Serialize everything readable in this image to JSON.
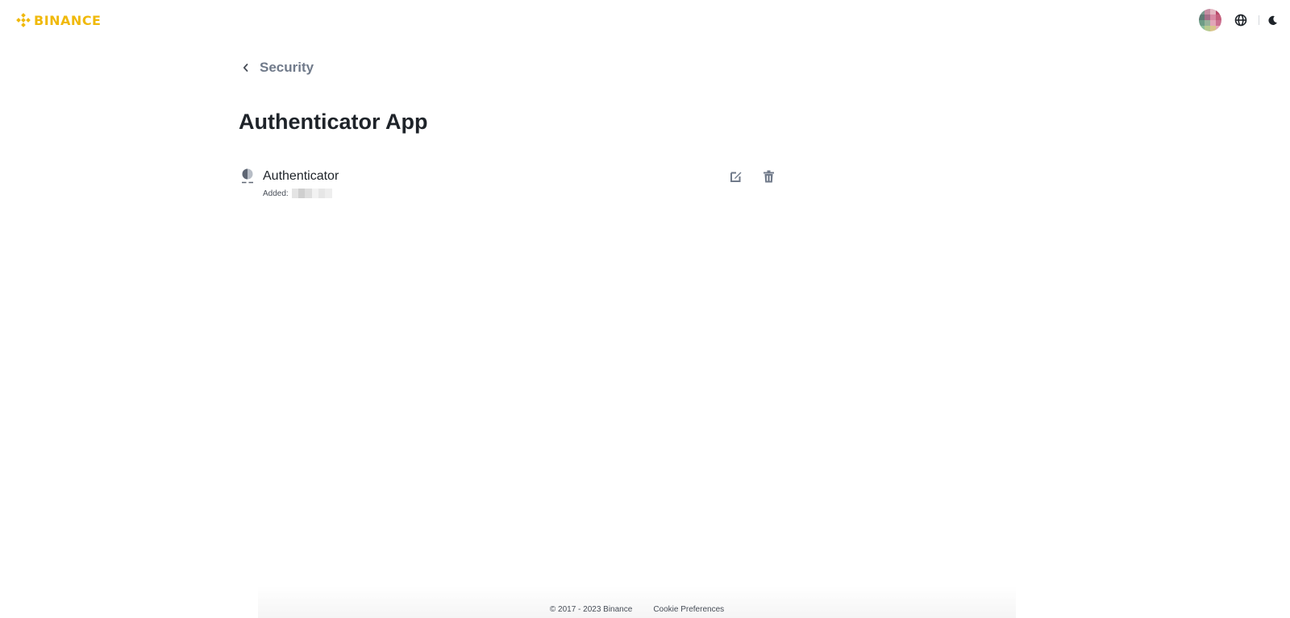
{
  "header": {
    "logo_text": "BINANCE",
    "brand_color": "#f0b90b",
    "icons": [
      "avatar",
      "globe-icon",
      "moon-icon"
    ]
  },
  "main": {
    "back_label": "Security",
    "title": "Authenticator App",
    "authenticator": {
      "name": "Authenticator",
      "added_label": "Added:"
    }
  },
  "footer": {
    "copyright": "© 2017 - 2023 Binance",
    "cookie_link": "Cookie Preferences"
  }
}
